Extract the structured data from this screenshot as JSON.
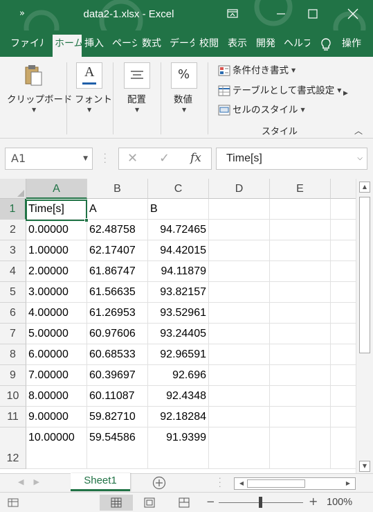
{
  "window": {
    "title": "data2-1.xlsx  -  Excel",
    "qat_glyph": "»"
  },
  "ribbon_tabs": [
    {
      "label": "ファイル",
      "active": false
    },
    {
      "label": "ホーム",
      "active": true
    },
    {
      "label": "挿入",
      "active": false
    },
    {
      "label": "ページ",
      "active": false
    },
    {
      "label": "数式",
      "active": false
    },
    {
      "label": "データ",
      "active": false
    },
    {
      "label": "校閲",
      "active": false
    },
    {
      "label": "表示",
      "active": false
    },
    {
      "label": "開発",
      "active": false
    },
    {
      "label": "ヘルプ",
      "active": false
    },
    {
      "label": "操作",
      "active": false
    }
  ],
  "ribbon": {
    "clipboard_label": "クリップボード",
    "font_label": "フォント",
    "alignment_label": "配置",
    "number_label": "数値",
    "number_icon": "%",
    "font_icon_letter": "A",
    "conditional_formatting": "条件付き書式",
    "format_as_table": "テーブルとして書式設定",
    "cell_styles": "セルのスタイル",
    "styles_group_label": "スタイル"
  },
  "formula_bar": {
    "name_box": "A1",
    "cancel_icon": "✕",
    "enter_icon": "✓",
    "fx_label": "fx",
    "content": "Time[s]"
  },
  "grid": {
    "columns": [
      "A",
      "B",
      "C",
      "D",
      "E"
    ],
    "selected_column": "A",
    "selected_row": "1",
    "rows": [
      {
        "num": "1",
        "cells": [
          "Time[s]",
          "A",
          "B",
          "",
          ""
        ]
      },
      {
        "num": "2",
        "cells": [
          "0.00000",
          "62.48758",
          "94.72465",
          "",
          ""
        ]
      },
      {
        "num": "3",
        "cells": [
          "1.00000",
          "62.17407",
          "94.42015",
          "",
          ""
        ]
      },
      {
        "num": "4",
        "cells": [
          "2.00000",
          "61.86747",
          "94.11879",
          "",
          ""
        ]
      },
      {
        "num": "5",
        "cells": [
          "3.00000",
          "61.56635",
          "93.82157",
          "",
          ""
        ]
      },
      {
        "num": "6",
        "cells": [
          "4.00000",
          "61.26953",
          "93.52961",
          "",
          ""
        ]
      },
      {
        "num": "7",
        "cells": [
          "5.00000",
          "60.97606",
          "93.24405",
          "",
          ""
        ]
      },
      {
        "num": "8",
        "cells": [
          "6.00000",
          "60.68533",
          "92.96591",
          "",
          ""
        ]
      },
      {
        "num": "9",
        "cells": [
          "7.00000",
          "60.39697",
          "92.696",
          "",
          ""
        ]
      },
      {
        "num": "10",
        "cells": [
          "8.00000",
          "60.11087",
          "92.4348",
          "",
          ""
        ]
      },
      {
        "num": "11",
        "cells": [
          "9.00000",
          "59.82710",
          "92.18284",
          "",
          ""
        ]
      },
      {
        "num": "12",
        "cells": [
          "10.00000",
          "59.54586",
          "91.9399",
          "",
          ""
        ]
      }
    ]
  },
  "sheets": {
    "active": "Sheet1",
    "add_icon": "+"
  },
  "status": {
    "zoom": "100%",
    "zoom_minus": "−",
    "zoom_plus": "+"
  },
  "colors": {
    "accent": "#217346",
    "ribbon_bg": "#f3f3f3"
  }
}
